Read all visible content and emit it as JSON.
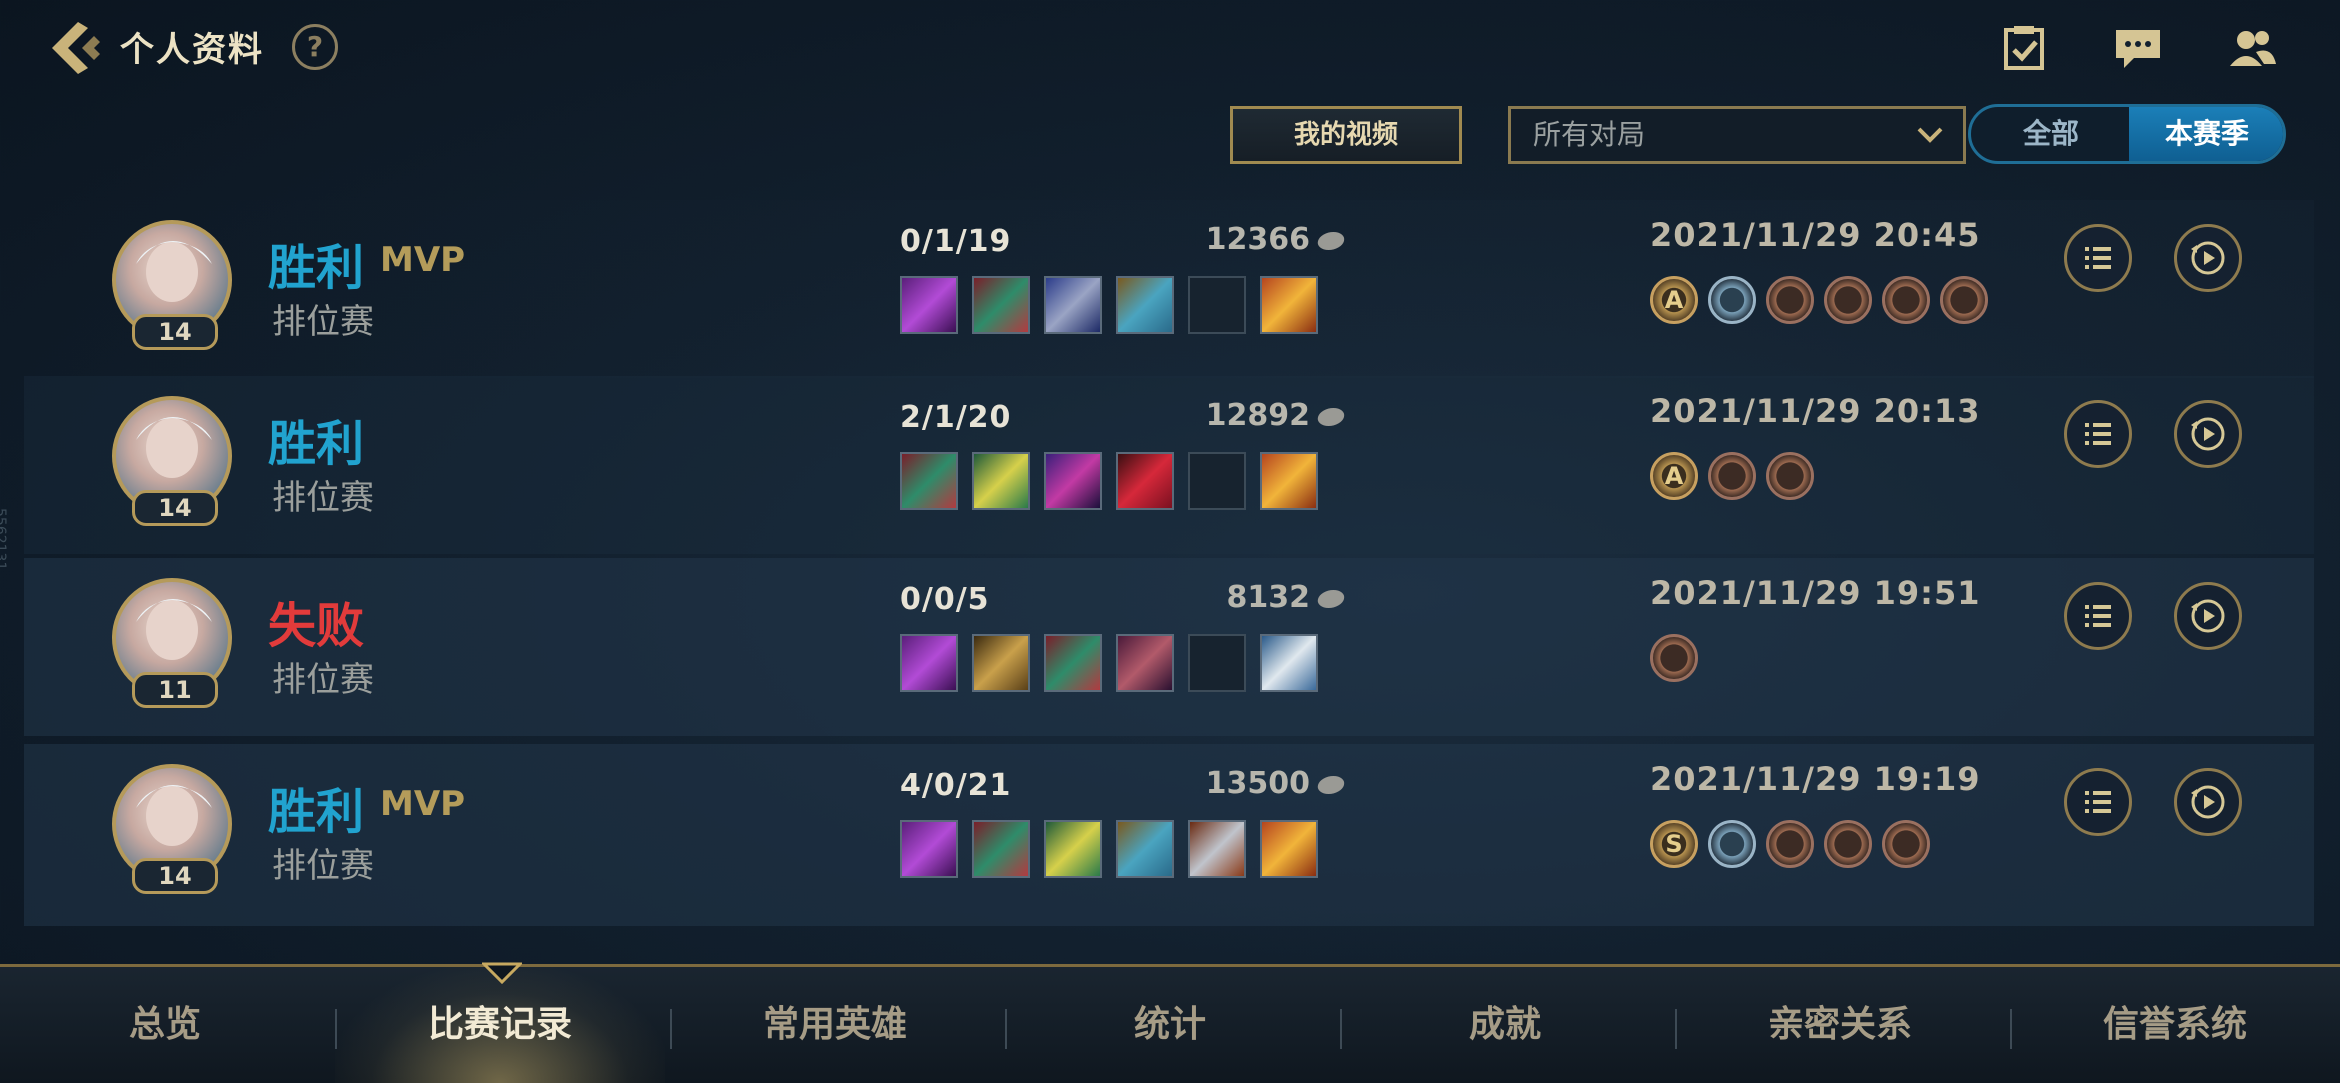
{
  "header": {
    "title": "个人资料",
    "help_label": "?"
  },
  "filters": {
    "my_videos_label": "我的视频",
    "match_filter_value": "所有对局",
    "segment_all": "全部",
    "segment_season": "本赛季"
  },
  "side_text": "5562131",
  "matches": [
    {
      "result": "胜利",
      "mvp": "MVP",
      "mode": "排位赛",
      "level": "14",
      "kda": "0/1/19",
      "gold": "12366",
      "datetime": "2021/11/29 20:45",
      "items": [
        "purple-staff",
        "green-mask",
        "knight-helm",
        "blue-armor",
        "empty",
        "gold-emblem"
      ],
      "badges": [
        {
          "type": "gold",
          "letter": "A"
        },
        {
          "type": "blue",
          "letter": ""
        },
        {
          "type": "bronze",
          "letter": ""
        },
        {
          "type": "bronze",
          "letter": ""
        },
        {
          "type": "bronze",
          "letter": ""
        },
        {
          "type": "bronze",
          "letter": ""
        }
      ]
    },
    {
      "result": "胜利",
      "mvp": "",
      "mode": "排位赛",
      "level": "14",
      "kda": "2/1/20",
      "gold": "12892",
      "datetime": "2021/11/29 20:13",
      "items": [
        "green-mask",
        "green-orb",
        "witch-hat",
        "red-gem",
        "empty",
        "gold-emblem"
      ],
      "badges": [
        {
          "type": "gold",
          "letter": "A"
        },
        {
          "type": "bronze",
          "letter": ""
        },
        {
          "type": "bronze",
          "letter": ""
        }
      ]
    },
    {
      "result": "失败",
      "mvp": "",
      "mode": "排位赛",
      "level": "11",
      "kda": "0/0/5",
      "gold": "8132",
      "datetime": "2021/11/29 19:51",
      "items": [
        "purple-staff",
        "gold-armor",
        "green-mask",
        "spell-book",
        "empty",
        "white-beast"
      ],
      "badges": [
        {
          "type": "bronze",
          "letter": ""
        }
      ]
    },
    {
      "result": "胜利",
      "mvp": "MVP",
      "mode": "排位赛",
      "level": "14",
      "kda": "4/0/21",
      "gold": "13500",
      "datetime": "2021/11/29 19:19",
      "items": [
        "purple-staff",
        "green-mask",
        "green-orb",
        "blue-armor",
        "silver-wings",
        "gold-emblem"
      ],
      "badges": [
        {
          "type": "gold",
          "letter": "S"
        },
        {
          "type": "blue",
          "letter": ""
        },
        {
          "type": "bronze",
          "letter": ""
        },
        {
          "type": "bronze",
          "letter": ""
        },
        {
          "type": "bronze",
          "letter": ""
        }
      ]
    }
  ],
  "nav": {
    "tabs": [
      "总览",
      "比赛记录",
      "常用英雄",
      "统计",
      "成就",
      "亲密关系",
      "信誉系统"
    ],
    "active_index": 1
  },
  "colors": {
    "win": "#21a3cf",
    "lose": "#e23b3b",
    "accent_gold": "#b59a5a",
    "segment_active": "#1b7fb8"
  }
}
